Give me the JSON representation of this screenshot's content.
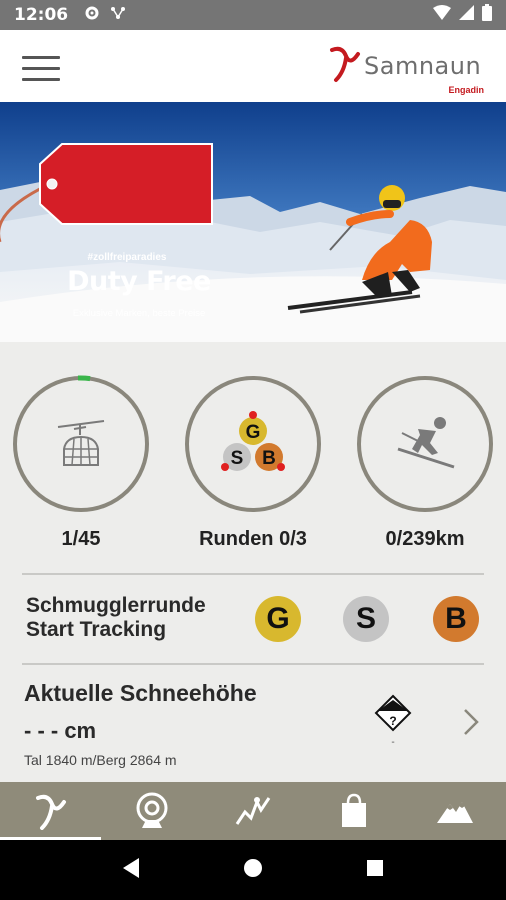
{
  "status_bar": {
    "time": "12:06"
  },
  "brand": {
    "name": "Samnaun",
    "region": "Engadin"
  },
  "hero": {
    "tag_hashtag": "#zollfreiparadies",
    "tag_title": "Duty Free",
    "tag_subtitle": "Exklusive Marken, beste Preise"
  },
  "stats": [
    {
      "icon": "gondola-icon",
      "label": "1/45",
      "progress": 0.022
    },
    {
      "icon": "gsb-rounds-icon",
      "label": "Runden 0/3"
    },
    {
      "icon": "skier-icon",
      "label": "0/239km"
    }
  ],
  "rounds_icon_letters": {
    "g": "G",
    "s": "S",
    "b": "B"
  },
  "tracking": {
    "title_line1": "Schmugglerrunde",
    "title_line2": "Start Tracking",
    "badges": [
      {
        "letter": "G",
        "color": "#d8b82e"
      },
      {
        "letter": "S",
        "color": "#c4c4c4"
      },
      {
        "letter": "B",
        "color": "#d27a2e"
      }
    ]
  },
  "snow": {
    "title": "Aktuelle Schneehöhe",
    "value": "- - - cm",
    "elevation": "Tal 1840 m/Berg 2864 m",
    "danger_level": "?",
    "danger_caption": "-"
  },
  "bottom_nav": [
    {
      "icon": "samnaun-logo-icon",
      "active": true
    },
    {
      "icon": "webcam-icon",
      "active": false
    },
    {
      "icon": "activity-icon",
      "active": false
    },
    {
      "icon": "shopping-bag-icon",
      "active": false
    },
    {
      "icon": "mountain-icon",
      "active": false
    }
  ],
  "colors": {
    "accent_red": "#c41a1f",
    "nav_bar": "#8f8b7a",
    "ring": "#8a877c",
    "progress_green": "#3ab54a"
  }
}
